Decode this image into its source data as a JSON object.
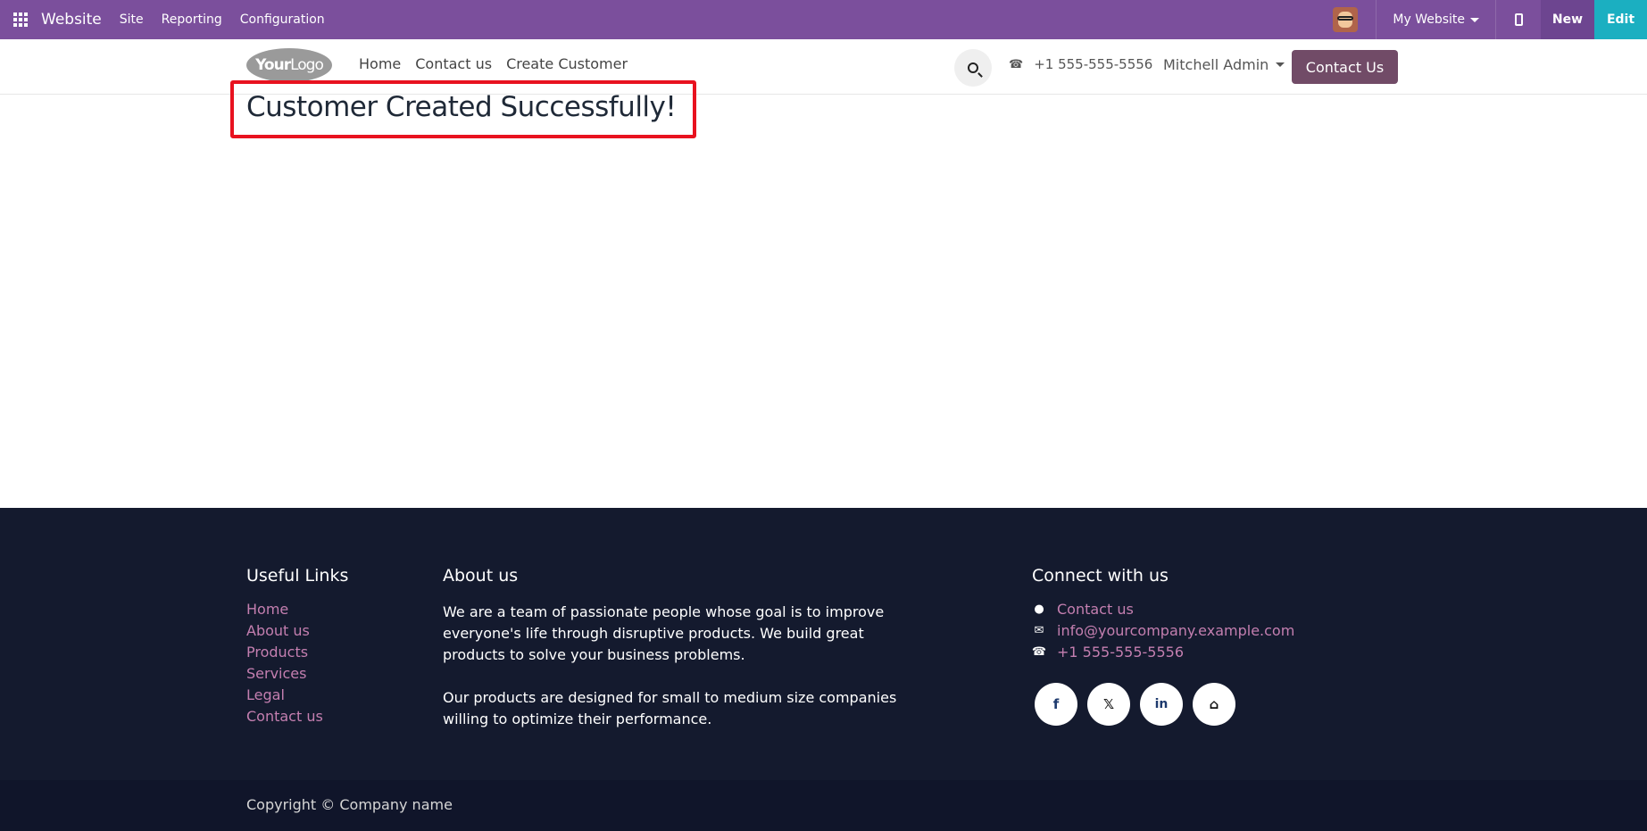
{
  "topbar": {
    "app_name": "Website",
    "menus": [
      "Site",
      "Reporting",
      "Configuration"
    ],
    "website_selector": "My Website",
    "new_label": "New",
    "edit_label": "Edit",
    "colors": {
      "bar": "#7b4f9c",
      "new": "#6d4590",
      "edit": "#1bafc1"
    }
  },
  "header": {
    "logo_bold": "Your",
    "logo_rest": "Logo",
    "nav": [
      "Home",
      "Contact us",
      "Create Customer"
    ],
    "phone": "+1 555-555-5556",
    "user": "Mitchell Admin",
    "cta": "Contact Us",
    "cta_color": "#714b67"
  },
  "main": {
    "title": "Customer Created Successfully!",
    "highlight_color": "#e8121f"
  },
  "footer": {
    "useful_links_title": "Useful Links",
    "useful_links": [
      "Home",
      "About us",
      "Products",
      "Services",
      "Legal",
      "Contact us"
    ],
    "about_title": "About us",
    "about_p1": "We are a team of passionate people whose goal is to improve everyone's life through disruptive products. We build great products to solve your business problems.",
    "about_p2": "Our products are designed for small to medium size companies willing to optimize their performance.",
    "connect_title": "Connect with us",
    "connect": {
      "contact": "Contact us",
      "email": "info@yourcompany.example.com",
      "phone": "+1 555-555-5556"
    },
    "social": [
      "facebook-icon",
      "x-icon",
      "linkedin-icon",
      "home-icon"
    ],
    "copyright": "Copyright © Company name",
    "link_color": "#c47fb0",
    "bg": "#141a2e"
  }
}
